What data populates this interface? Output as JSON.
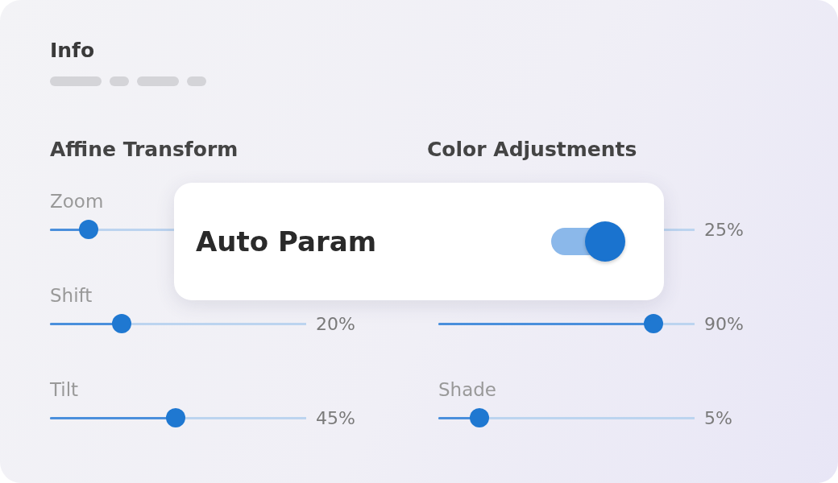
{
  "info": {
    "title": "Info"
  },
  "sections": [
    {
      "title": "Affine Transform",
      "indented": false,
      "sliders": [
        {
          "label": "Zoom",
          "level": 0.15
        },
        {
          "label": "Shift",
          "level": 0.28,
          "value": "20%"
        },
        {
          "label": "Tilt",
          "level": 0.49,
          "value": "45%"
        }
      ]
    },
    {
      "title": "Color Adjustments",
      "indented": true,
      "sliders": [
        {
          "value": "25%"
        },
        {
          "level": 0.84,
          "value": "90%"
        },
        {
          "label": "Shade",
          "level": 0.16,
          "value": "5%"
        }
      ]
    }
  ],
  "auto_param": {
    "label": "Auto Param",
    "on": true
  }
}
